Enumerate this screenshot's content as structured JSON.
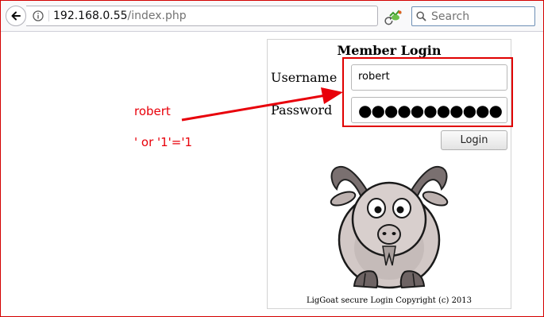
{
  "browser": {
    "url_host": "192.168.0.55",
    "url_path": "/index.php",
    "search_placeholder": "Search"
  },
  "annotations": {
    "username_text": "robert",
    "password_text": "' or '1'='1",
    "color": "#e8000a"
  },
  "login": {
    "title": "Member Login",
    "username_label": "Username",
    "password_label": "Password",
    "username_value": "robert",
    "password_value": "●●●●●●●●●●●",
    "button_label": "Login",
    "copyright": "LigGoat secure Login Copyright (c) 2013"
  },
  "icons": [
    "back-arrow-icon",
    "info-icon",
    "reload-icon",
    "addon-icon",
    "search-icon",
    "goat-mascot"
  ]
}
